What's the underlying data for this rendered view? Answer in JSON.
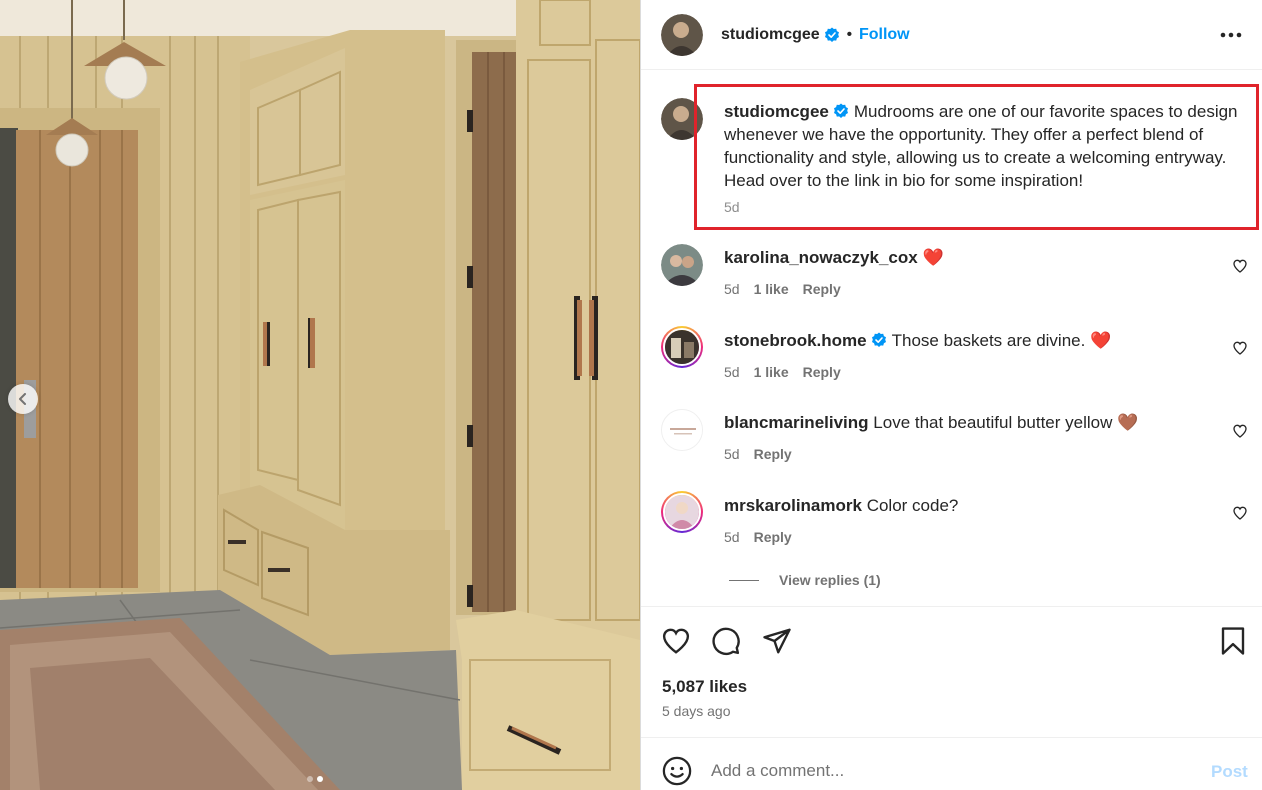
{
  "post": {
    "author": "studiomcgee",
    "follow_label": "Follow",
    "separator": "•",
    "caption": "Mudrooms are one of our favorite spaces to design whenever we have the opportunity. They offer a perfect blend of functionality and style, allowing us to create a welcoming entryway. Head over to the link in bio for some inspiration!",
    "caption_time": "5d",
    "likes": "5,087 likes",
    "posted": "5 days ago",
    "carousel_slide": 2,
    "carousel_total": 2
  },
  "comments": [
    {
      "user": "karolina_nowaczyk_cox",
      "text": "❤️",
      "time": "5d",
      "likes": "1 like",
      "reply": "Reply",
      "verified": false,
      "ring": false
    },
    {
      "user": "stonebrook.home",
      "text": "Those baskets are divine. ❤️",
      "time": "5d",
      "likes": "1 like",
      "reply": "Reply",
      "verified": true,
      "ring": true
    },
    {
      "user": "blancmarineliving",
      "text": "Love that beautiful butter yellow 🤎",
      "time": "5d",
      "likes": "",
      "reply": "Reply",
      "verified": false,
      "ring": false
    },
    {
      "user": "mrskarolinamork",
      "text": "Color code?",
      "time": "5d",
      "likes": "",
      "reply": "Reply",
      "verified": false,
      "ring": true
    }
  ],
  "view_replies": "View replies (1)",
  "add_comment": {
    "placeholder": "Add a comment...",
    "post_label": "Post"
  },
  "colors": {
    "accent": "#0095f6",
    "highlight_box": "#e0232b",
    "post_disabled": "#b3dbff",
    "verified": "#0095f6"
  },
  "icons": [
    "more-icon",
    "verified-icon",
    "heart-icon",
    "comment-icon",
    "share-icon",
    "bookmark-icon",
    "emoji-icon",
    "chevron-left-icon"
  ]
}
